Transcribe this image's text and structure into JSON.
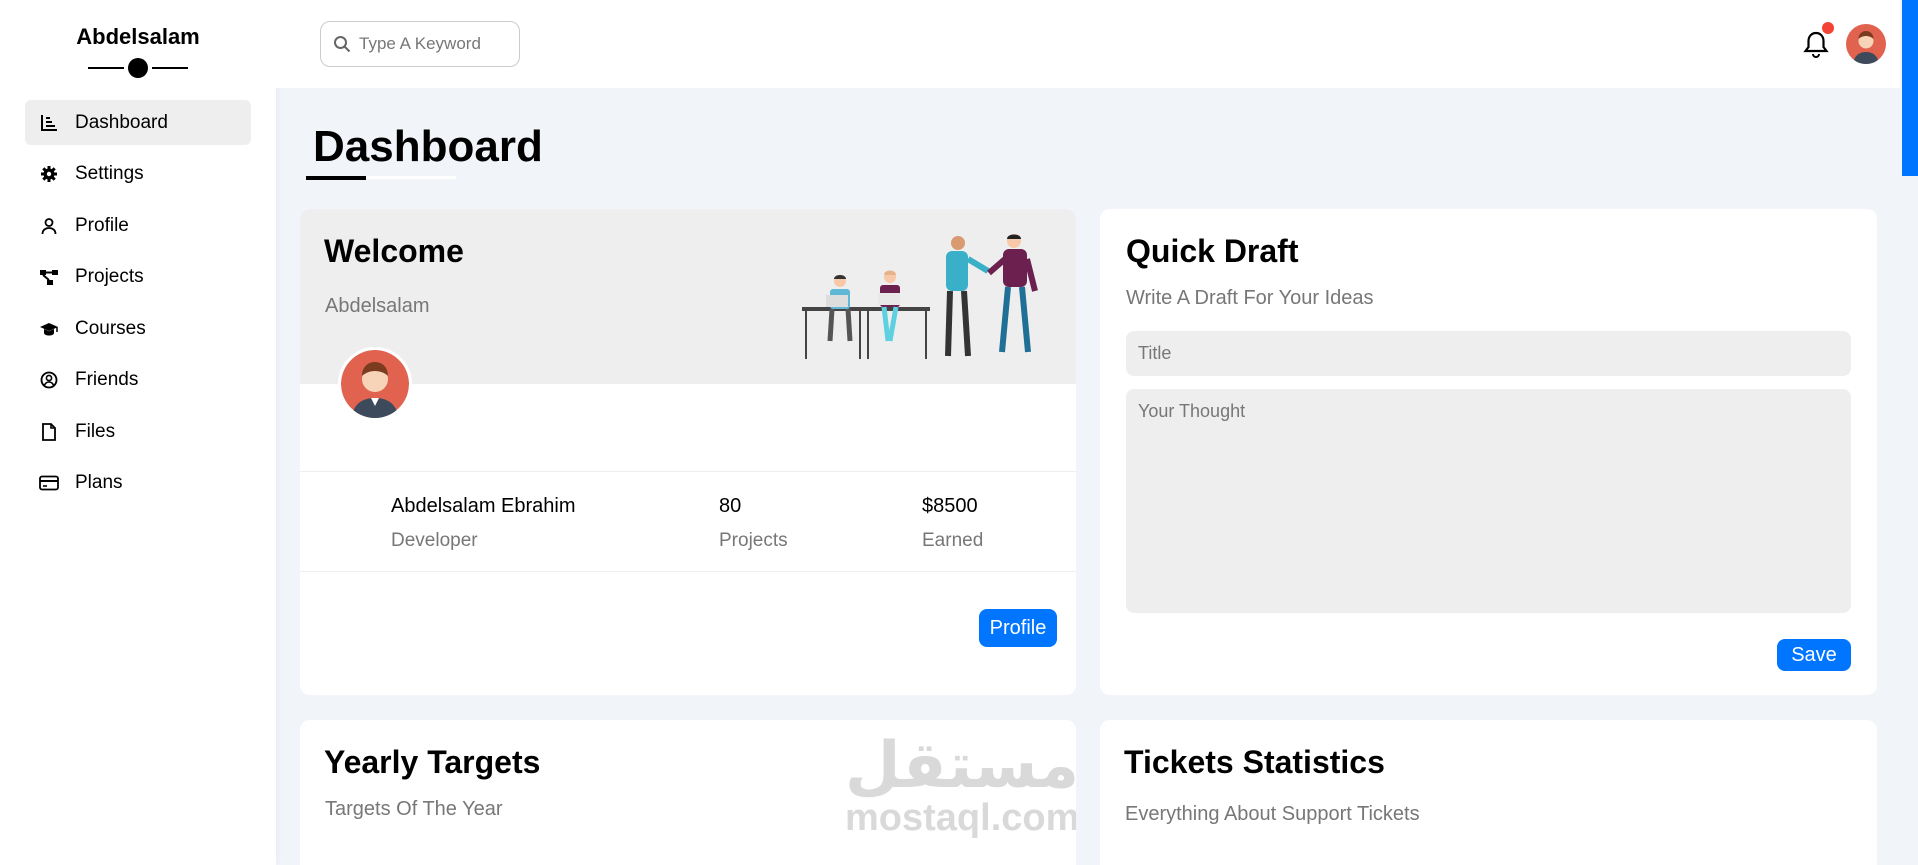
{
  "sidebar": {
    "brand": "Abdelsalam",
    "items": [
      {
        "label": "Dashboard",
        "icon": "chart-icon"
      },
      {
        "label": "Settings",
        "icon": "gear-icon"
      },
      {
        "label": "Profile",
        "icon": "user-icon"
      },
      {
        "label": "Projects",
        "icon": "project-diagram-icon"
      },
      {
        "label": "Courses",
        "icon": "graduation-cap-icon"
      },
      {
        "label": "Friends",
        "icon": "user-circle-icon"
      },
      {
        "label": "Files",
        "icon": "file-icon"
      },
      {
        "label": "Plans",
        "icon": "credit-card-icon"
      }
    ]
  },
  "header": {
    "search_placeholder": "Type A Keyword"
  },
  "page": {
    "title": "Dashboard"
  },
  "welcome": {
    "title": "Welcome",
    "subtitle": "Abdelsalam",
    "name": "Abdelsalam Ebrahim",
    "role": "Developer",
    "projects_value": "80",
    "projects_label": "Projects",
    "earned_value": "$8500",
    "earned_label": "Earned",
    "button": "Profile"
  },
  "quick_draft": {
    "title": "Quick Draft",
    "subtitle": "Write A Draft For Your Ideas",
    "title_placeholder": "Title",
    "thought_placeholder": "Your Thought",
    "button": "Save"
  },
  "yearly_targets": {
    "title": "Yearly Targets",
    "subtitle": "Targets Of The Year"
  },
  "tickets": {
    "title": "Tickets Statistics",
    "subtitle": "Everything About Support Tickets"
  },
  "watermark": {
    "arabic": "مستقل",
    "latin": "mostaql.com"
  },
  "colors": {
    "accent": "#0075ff",
    "notification": "#f44336",
    "background": "#f1f5f9"
  }
}
